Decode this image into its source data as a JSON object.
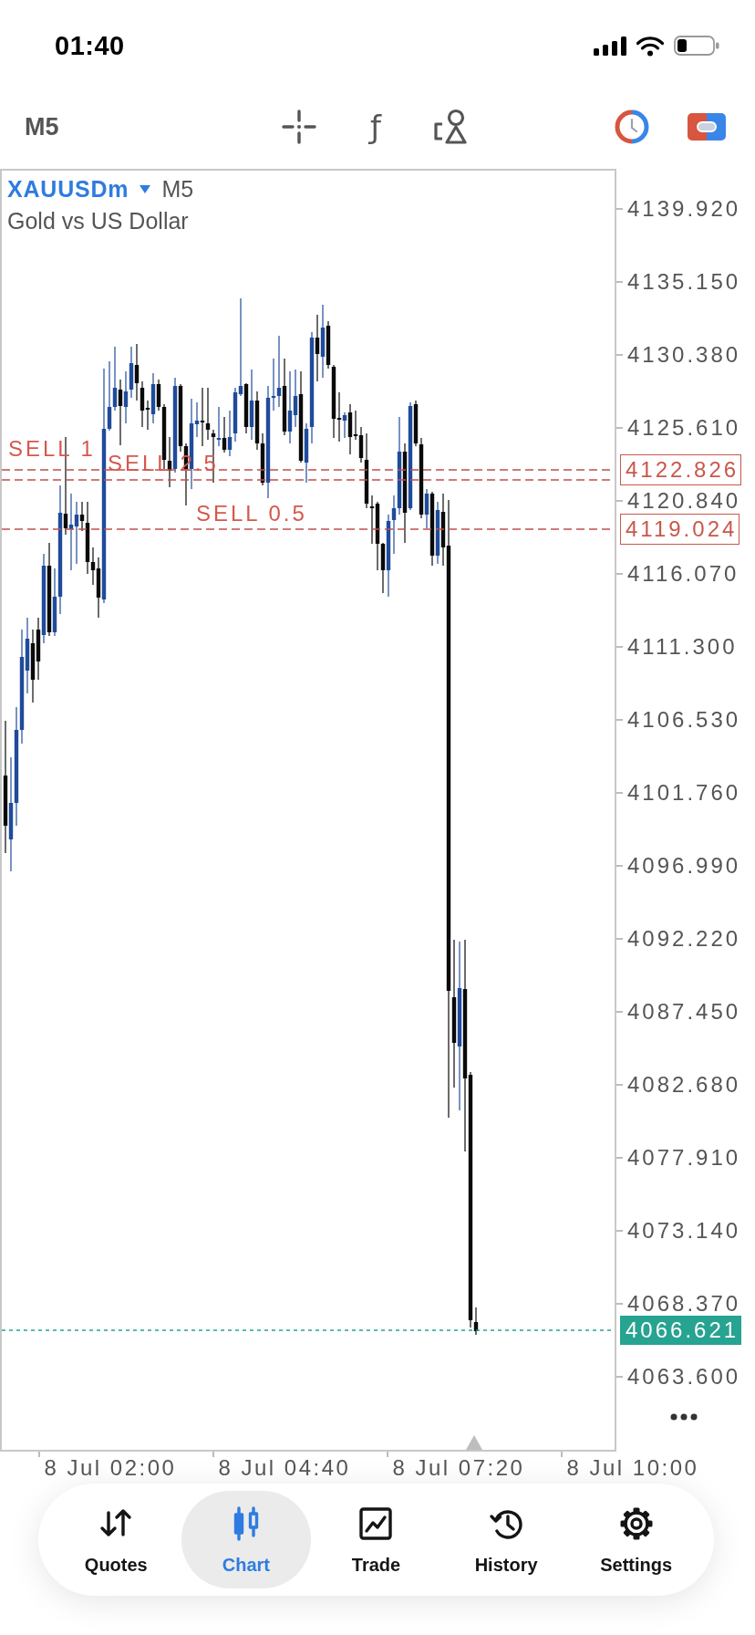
{
  "status_bar": {
    "time": "01:40"
  },
  "toolbar": {
    "timeframe": "M5",
    "indicator_glyph": "ƒ"
  },
  "chart": {
    "symbol": "XAUUSDm",
    "timeframe": "M5",
    "description": "Gold vs US Dollar",
    "order_lines": [
      {
        "label": "SELL 1",
        "price": "4122.826"
      },
      {
        "label": "SELL 2.5"
      },
      {
        "label": "SELL 0.5",
        "price": "4119.024"
      }
    ],
    "current_price": "4066.621",
    "price_axis": [
      "4139.920",
      "4135.150",
      "4130.380",
      "4125.610",
      "4120.840",
      "4116.070",
      "4111.300",
      "4106.530",
      "4101.760",
      "4096.990",
      "4092.220",
      "4087.450",
      "4082.680",
      "4077.910",
      "4073.140",
      "4068.370",
      "4063.600"
    ],
    "time_axis": [
      "8 Jul 02:00",
      "8 Jul 04:40",
      "8 Jul 07:20",
      "8 Jul 10:00"
    ]
  },
  "tab_bar": {
    "tabs": [
      {
        "label": "Quotes",
        "selected": false
      },
      {
        "label": "Chart",
        "selected": true
      },
      {
        "label": "Trade",
        "selected": false
      },
      {
        "label": "History",
        "selected": false
      },
      {
        "label": "Settings",
        "selected": false
      }
    ]
  }
}
